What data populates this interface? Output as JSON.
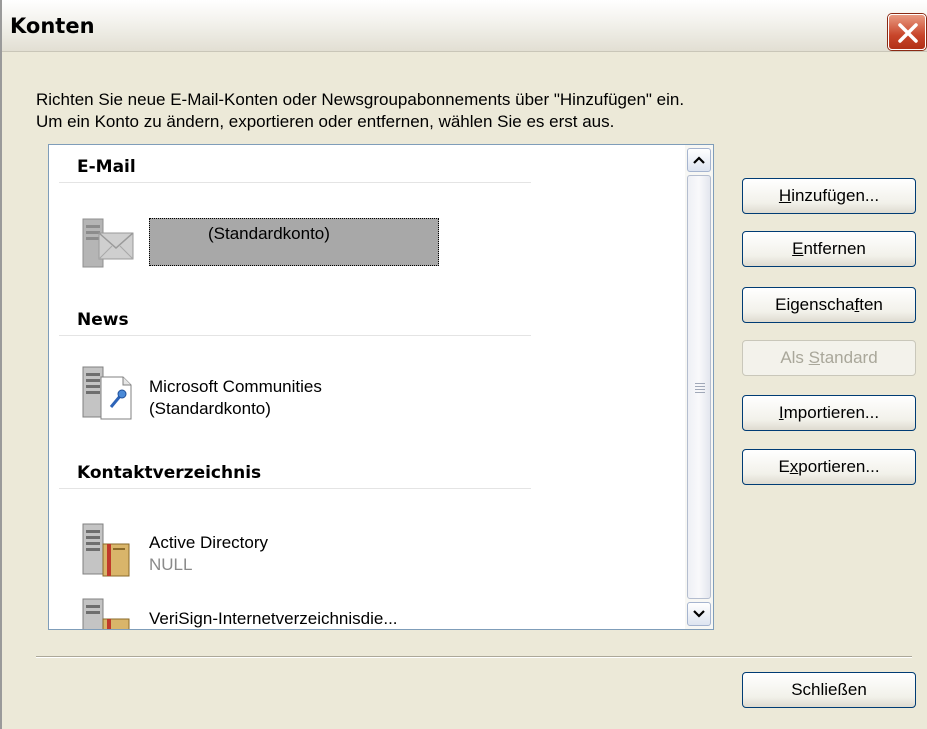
{
  "window": {
    "title": "Konten"
  },
  "instructions": {
    "line1": "Richten Sie neue E-Mail-Konten oder Newsgroupabonnements über \"Hinzufügen\" ein.",
    "line2": "Um ein Konto zu ändern, exportieren oder entfernen, wählen Sie es erst aus."
  },
  "sections": {
    "email": {
      "header": "E-Mail",
      "items": [
        {
          "name": "(Standardkonto)",
          "icon": "mail-server-icon",
          "selected": true
        }
      ]
    },
    "news": {
      "header": "News",
      "items": [
        {
          "line1": "Microsoft Communities",
          "line2": "(Standardkonto)",
          "icon": "news-server-icon"
        }
      ]
    },
    "directory": {
      "header": "Kontaktverzeichnis",
      "items": [
        {
          "line1": "Active Directory",
          "line2": "NULL",
          "icon": "directory-server-icon"
        },
        {
          "line1": "VeriSign-Internetverzeichnisdie...",
          "icon": "directory-server-icon"
        }
      ]
    }
  },
  "buttons": {
    "add": {
      "pre": "",
      "key": "H",
      "post": "inzufügen..."
    },
    "remove": {
      "pre": "",
      "key": "E",
      "post": "ntfernen"
    },
    "properties": {
      "pre": "Eigenscha",
      "key": "f",
      "post": "ten"
    },
    "default": {
      "pre": "Als ",
      "key": "S",
      "post": "tandard",
      "disabled": true
    },
    "import": {
      "pre": "",
      "key": "I",
      "post": "mportieren..."
    },
    "export": {
      "pre": "E",
      "key": "x",
      "post": "portieren..."
    },
    "close": {
      "label": "Schließen"
    }
  },
  "colors": {
    "accent_border": "#003c74",
    "selection": "#a8a8a8",
    "close": "#c8452a"
  }
}
